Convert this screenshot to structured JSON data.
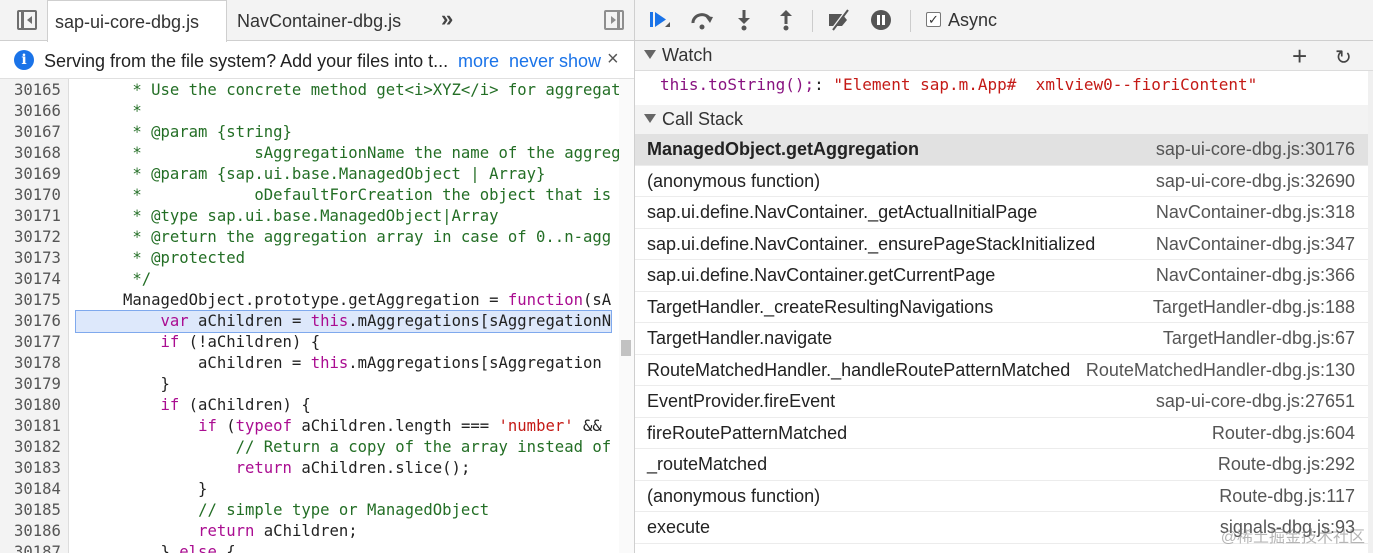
{
  "tabs": {
    "active": "sap-ui-core-dbg.js",
    "second": "NavContainer-dbg.js",
    "overflow": "»"
  },
  "infobar": {
    "message": "Serving from the file system? Add your files into t...",
    "link_more": "more",
    "link_never": "never show",
    "close": "×"
  },
  "code": {
    "lines": [
      {
        "n": "30165",
        "parts": [
          {
            "t": "      * Use the concrete method get<i>XYZ</i> for aggregat",
            "c": "c"
          }
        ]
      },
      {
        "n": "30166",
        "parts": [
          {
            "t": "      *",
            "c": "c"
          }
        ]
      },
      {
        "n": "30167",
        "parts": [
          {
            "t": "      * @param {string}",
            "c": "c"
          }
        ]
      },
      {
        "n": "30168",
        "parts": [
          {
            "t": "      *            sAggregationName the name of the aggreg",
            "c": "c"
          }
        ]
      },
      {
        "n": "30169",
        "parts": [
          {
            "t": "      * @param {sap.ui.base.ManagedObject | Array}",
            "c": "c"
          }
        ]
      },
      {
        "n": "30170",
        "parts": [
          {
            "t": "      *            oDefaultForCreation the object that is",
            "c": "c"
          }
        ]
      },
      {
        "n": "30171",
        "parts": [
          {
            "t": "      * @type sap.ui.base.ManagedObject|Array",
            "c": "c"
          }
        ]
      },
      {
        "n": "30172",
        "parts": [
          {
            "t": "      * @return the aggregation array in case of 0..n-agg",
            "c": "c"
          }
        ]
      },
      {
        "n": "30173",
        "parts": [
          {
            "t": "      * @protected",
            "c": "c"
          }
        ]
      },
      {
        "n": "30174",
        "parts": [
          {
            "t": "      */",
            "c": "c"
          }
        ]
      },
      {
        "n": "30175",
        "parts": [
          {
            "t": "     ManagedObject.prototype.getAggregation = ",
            "c": ""
          },
          {
            "t": "function",
            "c": "k"
          },
          {
            "t": "(sA",
            "c": ""
          }
        ]
      },
      {
        "n": "30176",
        "hl": true,
        "parts": [
          {
            "t": "         ",
            "c": ""
          },
          {
            "t": "var",
            "c": "k"
          },
          {
            "t": " aChildren = ",
            "c": ""
          },
          {
            "t": "this",
            "c": "k"
          },
          {
            "t": ".mAggregations[sAggregationN",
            "c": ""
          }
        ]
      },
      {
        "n": "30177",
        "parts": [
          {
            "t": "         ",
            "c": ""
          },
          {
            "t": "if",
            "c": "k"
          },
          {
            "t": " (!aChildren) {",
            "c": ""
          }
        ]
      },
      {
        "n": "30178",
        "parts": [
          {
            "t": "             aChildren = ",
            "c": ""
          },
          {
            "t": "this",
            "c": "k"
          },
          {
            "t": ".mAggregations[sAggregation",
            "c": ""
          }
        ]
      },
      {
        "n": "30179",
        "parts": [
          {
            "t": "         }",
            "c": ""
          }
        ]
      },
      {
        "n": "30180",
        "parts": [
          {
            "t": "         ",
            "c": ""
          },
          {
            "t": "if",
            "c": "k"
          },
          {
            "t": " (aChildren) {",
            "c": ""
          }
        ]
      },
      {
        "n": "30181",
        "parts": [
          {
            "t": "             ",
            "c": ""
          },
          {
            "t": "if",
            "c": "k"
          },
          {
            "t": " (",
            "c": ""
          },
          {
            "t": "typeof",
            "c": "k"
          },
          {
            "t": " aChildren.length === ",
            "c": ""
          },
          {
            "t": "'number'",
            "c": "s"
          },
          {
            "t": " &&",
            "c": ""
          }
        ]
      },
      {
        "n": "30182",
        "parts": [
          {
            "t": "                 ",
            "c": ""
          },
          {
            "t": "// Return a copy of the array instead of",
            "c": "c"
          }
        ]
      },
      {
        "n": "30183",
        "parts": [
          {
            "t": "                 ",
            "c": ""
          },
          {
            "t": "return",
            "c": "k"
          },
          {
            "t": " aChildren.slice();",
            "c": ""
          }
        ]
      },
      {
        "n": "30184",
        "parts": [
          {
            "t": "             }",
            "c": ""
          }
        ]
      },
      {
        "n": "30185",
        "parts": [
          {
            "t": "             ",
            "c": ""
          },
          {
            "t": "// simple type or ManagedObject",
            "c": "c"
          }
        ]
      },
      {
        "n": "30186",
        "parts": [
          {
            "t": "             ",
            "c": ""
          },
          {
            "t": "return",
            "c": "k"
          },
          {
            "t": " aChildren;",
            "c": ""
          }
        ]
      },
      {
        "n": "30187",
        "parts": [
          {
            "t": "         } ",
            "c": ""
          },
          {
            "t": "else",
            "c": "k"
          },
          {
            "t": " {",
            "c": ""
          }
        ]
      }
    ]
  },
  "toolbar": {
    "async_label": "Async",
    "async_checked": true,
    "icons": [
      "resume-icon",
      "step-over-icon",
      "step-into-icon",
      "step-out-icon",
      "deactivate-breakpoints-icon",
      "pause-on-exceptions-icon"
    ]
  },
  "watch": {
    "title": "Watch",
    "expression": "this.toString();",
    "separator": ": ",
    "value": "\"Element sap.m.App#  xmlview0--fioriContent\""
  },
  "callstack": {
    "title": "Call Stack",
    "frames": [
      {
        "fn": "ManagedObject.getAggregation",
        "loc": "sap-ui-core-dbg.js:30176",
        "selected": true
      },
      {
        "fn": "(anonymous function)",
        "loc": "sap-ui-core-dbg.js:32690"
      },
      {
        "fn": "sap.ui.define.NavContainer._getActualInitialPage",
        "loc": "NavContainer-dbg.js:318"
      },
      {
        "fn": "sap.ui.define.NavContainer._ensurePageStackInitialized",
        "loc": "NavContainer-dbg.js:347"
      },
      {
        "fn": "sap.ui.define.NavContainer.getCurrentPage",
        "loc": "NavContainer-dbg.js:366"
      },
      {
        "fn": "TargetHandler._createResultingNavigations",
        "loc": "TargetHandler-dbg.js:188"
      },
      {
        "fn": "TargetHandler.navigate",
        "loc": "TargetHandler-dbg.js:67"
      },
      {
        "fn": "RouteMatchedHandler._handleRoutePatternMatched",
        "loc": "RouteMatchedHandler-dbg.js:130"
      },
      {
        "fn": "EventProvider.fireEvent",
        "loc": "sap-ui-core-dbg.js:27651"
      },
      {
        "fn": "fireRoutePatternMatched",
        "loc": "Router-dbg.js:604"
      },
      {
        "fn": "_routeMatched",
        "loc": "Route-dbg.js:292"
      },
      {
        "fn": "(anonymous function)",
        "loc": "Route-dbg.js:117"
      },
      {
        "fn": "execute",
        "loc": "signals-dbg.js:93"
      }
    ]
  },
  "watermark": "@稀土掘金技术社区",
  "colors": {
    "accent": "#1a73e8",
    "selected_line": "#dde8fb",
    "comment": "#236e25",
    "keyword": "#aa0d91",
    "string": "#c41a16"
  }
}
